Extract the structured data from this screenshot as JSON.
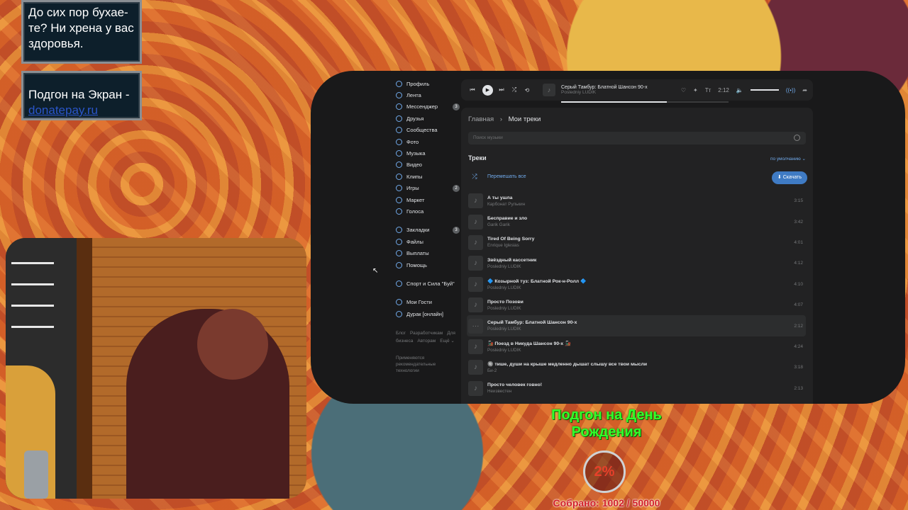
{
  "chat": {
    "message1": "До сих пор бухае-те? Ни хрена у вас здоровья.",
    "message2_text": "Подгон на Экран -",
    "message2_link": "donatepay.ru"
  },
  "sidebar": {
    "items": [
      {
        "label": "Профиль",
        "icon": "profile-icon"
      },
      {
        "label": "Лента",
        "icon": "feed-icon"
      },
      {
        "label": "Мессенджер",
        "icon": "messenger-icon",
        "badge": "3"
      },
      {
        "label": "Друзья",
        "icon": "friends-icon"
      },
      {
        "label": "Сообщества",
        "icon": "communities-icon"
      },
      {
        "label": "Фото",
        "icon": "photo-icon"
      },
      {
        "label": "Музыка",
        "icon": "music-icon"
      },
      {
        "label": "Видео",
        "icon": "video-icon"
      },
      {
        "label": "Клипы",
        "icon": "clips-icon"
      },
      {
        "label": "Игры",
        "icon": "games-icon",
        "badge": "2"
      },
      {
        "label": "Маркет",
        "icon": "market-icon"
      },
      {
        "label": "Голоса",
        "icon": "votes-icon"
      }
    ],
    "items2": [
      {
        "label": "Закладки",
        "icon": "bookmarks-icon",
        "badge": "3"
      },
      {
        "label": "Файлы",
        "icon": "files-icon"
      },
      {
        "label": "Выплаты",
        "icon": "payouts-icon"
      },
      {
        "label": "Помощь",
        "icon": "help-icon"
      }
    ],
    "group": "Спорт и Сила \"Буй\"",
    "apps": [
      {
        "label": "Мои Гости",
        "icon": "guests-icon"
      },
      {
        "label": "Дурак [онлайн]",
        "icon": "gamepad-icon"
      }
    ],
    "footer": [
      "Блог",
      "Разработчикам",
      "Для бизнеса",
      "Авторам",
      "Ещё ⌄"
    ],
    "note": "Применяются рекомендательные технологии"
  },
  "player": {
    "title": "Серый Тамбур: Блатной Шансон 90-х",
    "artist": "Posledniy LUDIK",
    "time": "2:12",
    "progress": 0.63
  },
  "content": {
    "breadcrumb_home": "Главная",
    "breadcrumb_sep": "›",
    "breadcrumb_current": "Мои треки",
    "search_placeholder": "Поиск музыки",
    "section_title": "Треки",
    "sort_label": "по умолчанию ⌄",
    "shuffle_label": "Перемешать все",
    "download_label": "Скачать"
  },
  "tracks": [
    {
      "title": "А ты ушла",
      "artist": "Карбонат Рулькин",
      "duration": "3:15"
    },
    {
      "title": "Бесправие и зло",
      "artist": "Garik Garik",
      "duration": "3:42"
    },
    {
      "title": "Tired Of Being Sorry",
      "artist": "Enrique Iglesias",
      "duration": "4:01"
    },
    {
      "title": "Звёздный кассетник",
      "artist": "Posledniy LUDIK",
      "duration": "4:12"
    },
    {
      "title": "🔷 Козырной туз: Блатной Рок-н-Ролл 🔷",
      "artist": "Posledniy LUDIK",
      "duration": "4:10"
    },
    {
      "title": "Просто Позови",
      "artist": "Posledniy LUDIK",
      "duration": "4:07"
    },
    {
      "title": "Серый Тамбур: Блатной Шансон 90-х",
      "artist": "Posledniy LUDIK",
      "duration": "2:12"
    },
    {
      "title": "🚂 Поезд в Никуда Шансон 90-х 🚂",
      "artist": "Posledniy LUDIK",
      "duration": "4:24"
    },
    {
      "title": "🔘 тише, души на крыше медленно дышат слышу все твои мысли",
      "artist": "Би-2",
      "duration": "3:18"
    },
    {
      "title": "Просто человек говно!",
      "artist": "Неизвестен",
      "duration": "2:13"
    }
  ],
  "donation": {
    "title": "Подгон на День Рождения",
    "percent": "2%",
    "collected": "Собрано: 1002 / 50000"
  }
}
